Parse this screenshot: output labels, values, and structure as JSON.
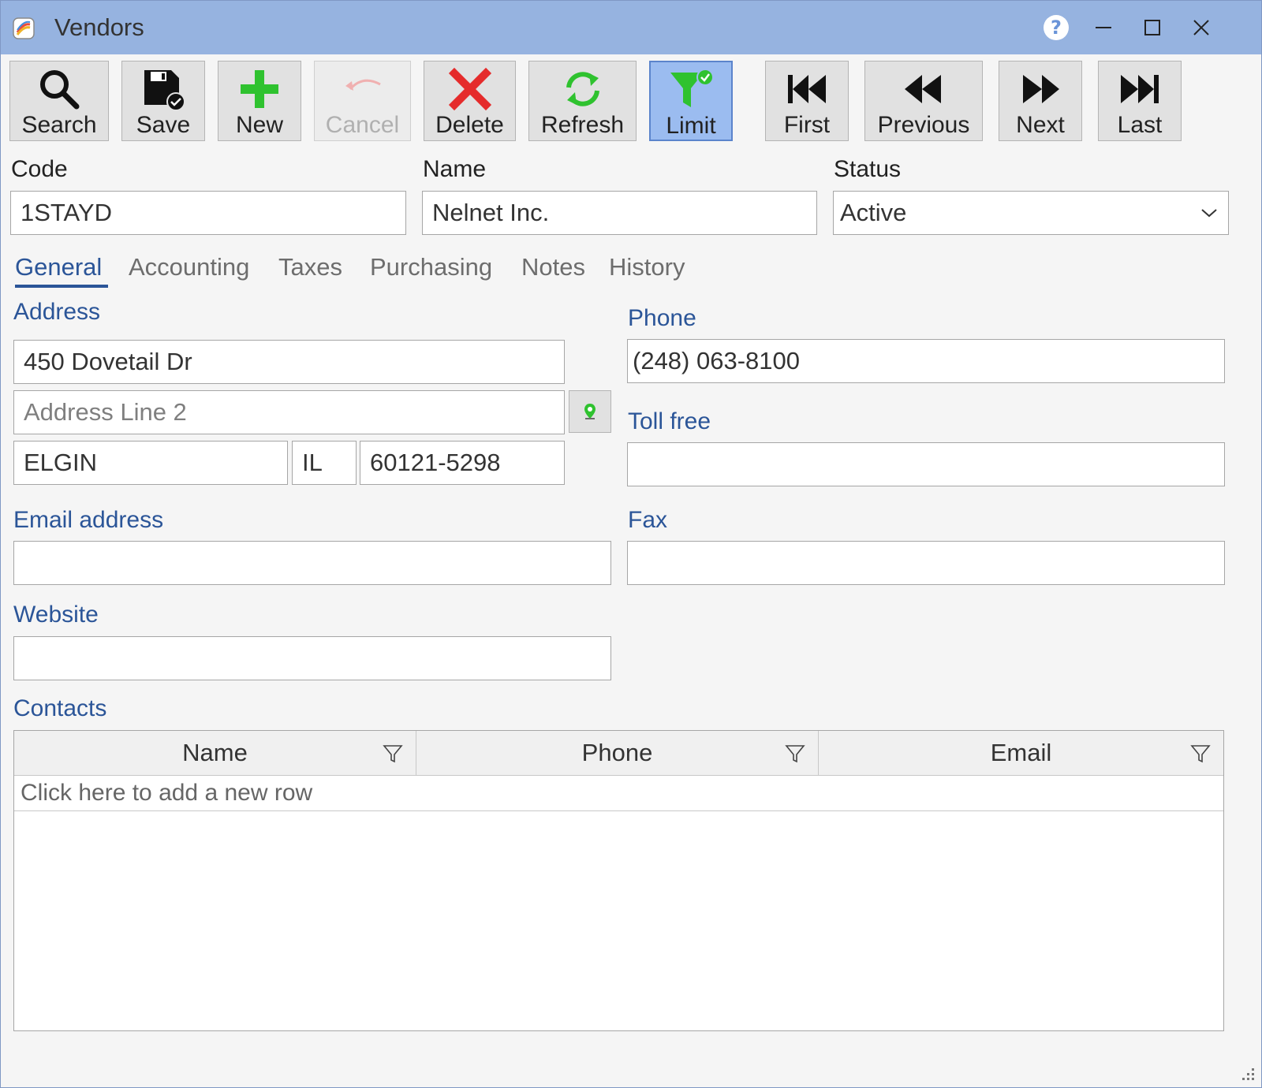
{
  "window": {
    "title": "Vendors"
  },
  "toolbar": {
    "search": "Search",
    "save": "Save",
    "new": "New",
    "cancel": "Cancel",
    "delete": "Delete",
    "refresh": "Refresh",
    "limit": "Limit",
    "first": "First",
    "previous": "Previous",
    "next": "Next",
    "last": "Last"
  },
  "header": {
    "code_label": "Code",
    "code_value": "1STAYD",
    "name_label": "Name",
    "name_value": "Nelnet Inc.",
    "status_label": "Status",
    "status_value": "Active"
  },
  "tabs": [
    {
      "label": "General",
      "active": true
    },
    {
      "label": "Accounting"
    },
    {
      "label": "Taxes"
    },
    {
      "label": "Purchasing"
    },
    {
      "label": "Notes"
    },
    {
      "label": "History"
    }
  ],
  "general": {
    "address_label": "Address",
    "address_line1": "450 Dovetail Dr",
    "address_line2_placeholder": "Address Line 2",
    "city": "ELGIN",
    "state": "IL",
    "zip": "60121-5298",
    "phone_label": "Phone",
    "phone_value": "(248) 063-8100",
    "tollfree_label": "Toll free",
    "tollfree_value": "",
    "email_label": "Email address",
    "email_value": "",
    "fax_label": "Fax",
    "fax_value": "",
    "website_label": "Website",
    "website_value": ""
  },
  "contacts": {
    "label": "Contacts",
    "columns": [
      "Name",
      "Phone",
      "Email"
    ],
    "new_row_text": "Click here to add a new row",
    "rows": []
  },
  "colors": {
    "titlebar": "#96b3e0",
    "accent": "#2b5598",
    "limit_active": "#9bbcf0",
    "green_icon": "#2fc22f",
    "red_icon": "#e52b2b"
  }
}
